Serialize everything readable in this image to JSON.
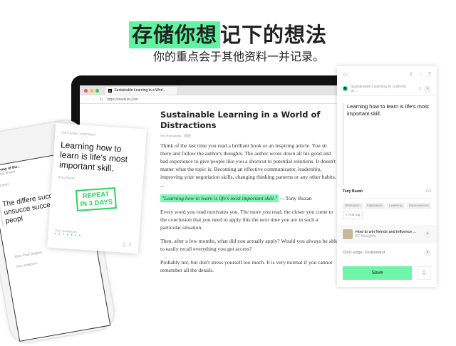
{
  "headline": {
    "highlight": "存储你想",
    "rest": "记下的想法",
    "subtitle": "你的重点会于其他资料一并记录。"
  },
  "browser": {
    "tab_title": "Sustainable Learning in a Worl...",
    "url": "https://medium.com"
  },
  "article": {
    "title": "Sustainable Learning in a World of Distractions",
    "toggle_label": "Start Highlighting",
    "paragraphs": [
      "Think of the last time you read a brilliant book or an inspiring article. You sit there and follow the author's thoughts. The author wrote down all his good and bad experience to give people like you a shortcut to potential solutions. It doesn't matter what the topic is: Becoming an effective communicator, leadership, improving your negotiation skills, changing thinking patterns or any other habits. ...",
      "Every word you read motivates you. The more you read, the closer you come to the conclusion that you need to apply this the next time you are in such a particular situation.",
      "Then, after a few months, what did you actually apply? Would you always be able to easily recall everything you got access?",
      "Probably not, but don't stress yourself too much. It is very normal if you cannot remember all the details."
    ],
    "quote": "\"Learning how to learn is life's most important skill.\"",
    "quote_author": "—Tony Buzan"
  },
  "panel": {
    "source": "Sustainable Learning in a World of...",
    "note": "Learning how to learn is life's most important skill.",
    "author": "Tony Buzan",
    "count": "154",
    "tags": [
      "Motivation",
      "Inspiration",
      "Learning",
      "Improvement"
    ],
    "add_tag": "+ Add tag",
    "book_title": "How to win friends and influence ...",
    "book_count": "67 thoughts",
    "note2": "Don't judge, Understand",
    "save": "Save"
  },
  "phone": {
    "title": "The way of the...",
    "author": "by Bob Brand",
    "label": "Success",
    "text": "The differe successf unsucce succe things peopl",
    "footer": "John Paul Degala",
    "repetitions": "Your repetitions"
  },
  "card": {
    "header": "Don't judge, understand",
    "text": "Learning how to learn is life's most important skill.",
    "author": "Tony Buzan",
    "stamp": "REPEAT IN 3 DAYS",
    "repetitions": "Your repetitions"
  }
}
